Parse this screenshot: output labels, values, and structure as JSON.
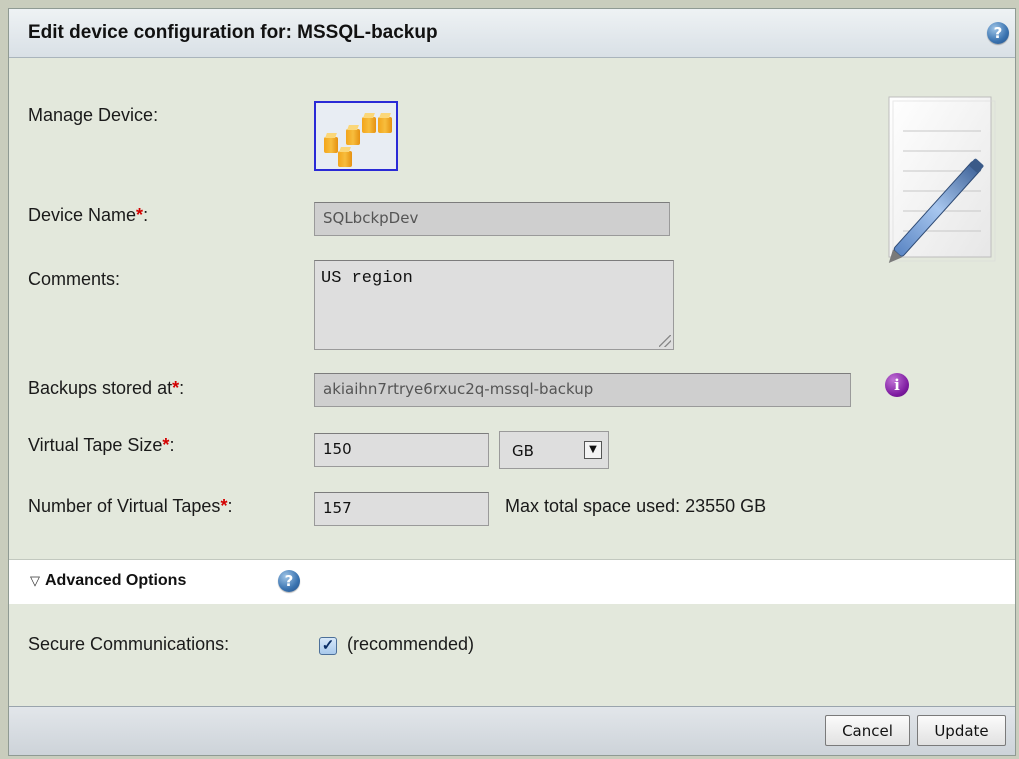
{
  "dialog": {
    "title": "Edit device configuration for: MSSQL-backup",
    "help_icon": "question-icon"
  },
  "form": {
    "manage_device_label": "Manage Device:",
    "device_icon": "aws-cubes-icon",
    "device_name_label": "Device Name",
    "device_name_value": "SQLbckpDev",
    "comments_label": "Comments:",
    "comments_value": "US region",
    "backups_label": "Backups stored at",
    "backups_value": "akiaihn7rtrye6rxuc2q-mssql-backup",
    "info_icon": "info-icon",
    "tape_size_label": "Virtual Tape Size",
    "tape_size_value": "150",
    "tape_unit_selected": "GB",
    "num_tapes_label": "Number of Virtual Tapes",
    "num_tapes_value": "157",
    "max_space_text": "Max total space used: 23550 GB",
    "required_marker": "*",
    "colon": ":"
  },
  "advanced": {
    "toggle_label": "Advanced Options",
    "triangle": "▽",
    "secure_label": "Secure Communications:",
    "secure_checked": true,
    "secure_note": "(recommended)"
  },
  "footer": {
    "cancel_label": "Cancel",
    "update_label": "Update"
  },
  "colors": {
    "body_bg": "#e3e8dc",
    "required": "#d30000",
    "info": "#7d1aa0",
    "help": "#3a73b0"
  }
}
